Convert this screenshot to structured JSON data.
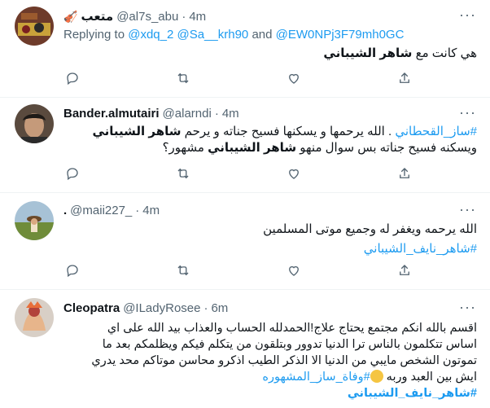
{
  "tweets": [
    {
      "name": "متعب",
      "name_badge": "🎻",
      "handle": "@al7s_abu",
      "dot": "·",
      "time": "4m",
      "replying_prefix": "Replying to",
      "replying_handles": "@xdq_2 @Sa__krh90",
      "replying_and": "and",
      "replying_last": "@EW0NPj3F79mh0GC",
      "text_plain": "هي كانت مع",
      "text_bold": "شاهر الشيباني"
    },
    {
      "name": "Bander.almutairi",
      "handle": "@alarndi",
      "dot": "·",
      "time": "4m",
      "line1_hashtag": "#ساز_القحطاني",
      "line1_text": ". الله يرحمها و يسكنها فسيح جناته و يرحم",
      "line1_bold": "شاهر الشيباني",
      "line2_text1": "ويسكنه فسيح جناته بس سوال منهو",
      "line2_bold": "شاهر الشيباني",
      "line2_text2": "مشهور؟"
    },
    {
      "name": ".",
      "handle": "@maii227_",
      "dot": "·",
      "time": "4m",
      "line1": "الله يرحمه ويغفر له وجميع موتى المسلمين",
      "hashtag": "#شاهر_نايف_الشيباني"
    },
    {
      "name": "Cleopatra",
      "handle": "@ILadyRosee",
      "dot": "·",
      "time": "6m",
      "line1": "اقسم بالله انكم مجتمع يحتاج علاج!الحمدلله الحساب والعذاب بيد الله على اي",
      "line2": "اساس تتكلمون بالناس ترا الدنيا تدوور وبتلقون من يتكلم فيكم ويظلمكم بعد ما",
      "line3": "تموتون الشخص مايبي من الدنيا الا الذكر الطيب اذكرو محاسن موتاكم محد يدري",
      "line4_text": "ايش بين العبد وربه",
      "line4_hashtag": "#وفاة_ساز_المشهوره",
      "hashtag2": "#شاهر_نايف_الشيباني"
    }
  ],
  "actions": [
    "reply-icon",
    "retweet-icon",
    "like-icon",
    "share-icon"
  ],
  "colors": {
    "link": "#1d9bf0",
    "muted": "#536471",
    "text": "#0f1419",
    "separator": "#eff3f4"
  }
}
